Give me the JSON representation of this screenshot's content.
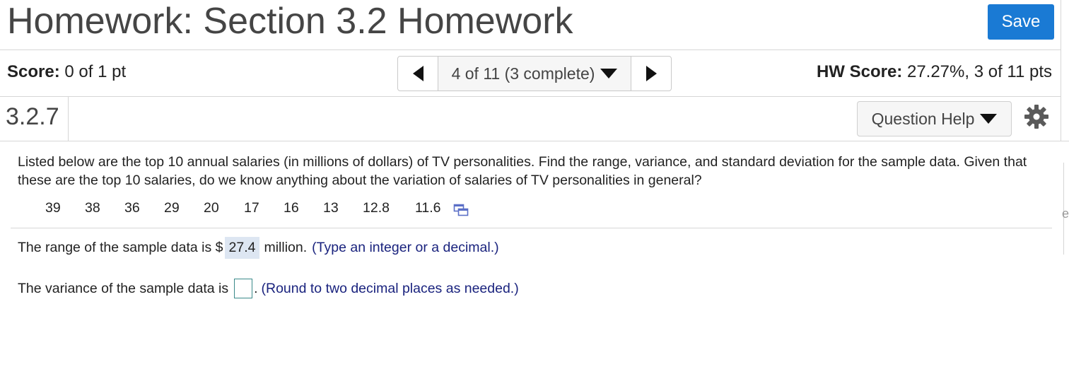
{
  "header": {
    "title": "Homework: Section 3.2 Homework",
    "save_label": "Save"
  },
  "status_bar": {
    "score_label": "Score:",
    "score_value": "0 of 1 pt",
    "nav_label": "4 of 11 (3 complete)",
    "hw_score_label": "HW Score:",
    "hw_score_value": "27.27%, 3 of 11 pts"
  },
  "question_bar": {
    "number": "3.2.7",
    "help_label": "Question Help"
  },
  "question": {
    "text": "Listed below are the top 10 annual salaries (in millions of dollars) of TV personalities. Find the range, variance, and standard deviation for the sample data. Given that these are the top 10 salaries, do we know anything about the variation of salaries of TV personalities in general?",
    "data_values": [
      "39",
      "38",
      "36",
      "29",
      "20",
      "17",
      "16",
      "13",
      "12.8",
      "11.6"
    ]
  },
  "answers": {
    "range_prefix": "The range of the sample data is $",
    "range_value": "27.4",
    "range_suffix": "million.",
    "range_hint": "(Type an integer or a decimal.)",
    "variance_prefix": "The variance of the sample data is",
    "variance_value": "",
    "variance_punct": ".",
    "variance_hint": "(Round to two decimal places as needed.)"
  },
  "side": {
    "stub_text": "e"
  },
  "colors": {
    "save_button": "#1a7ad4",
    "hint_text": "#1a237e",
    "answer_highlight": "#dde6f2"
  }
}
